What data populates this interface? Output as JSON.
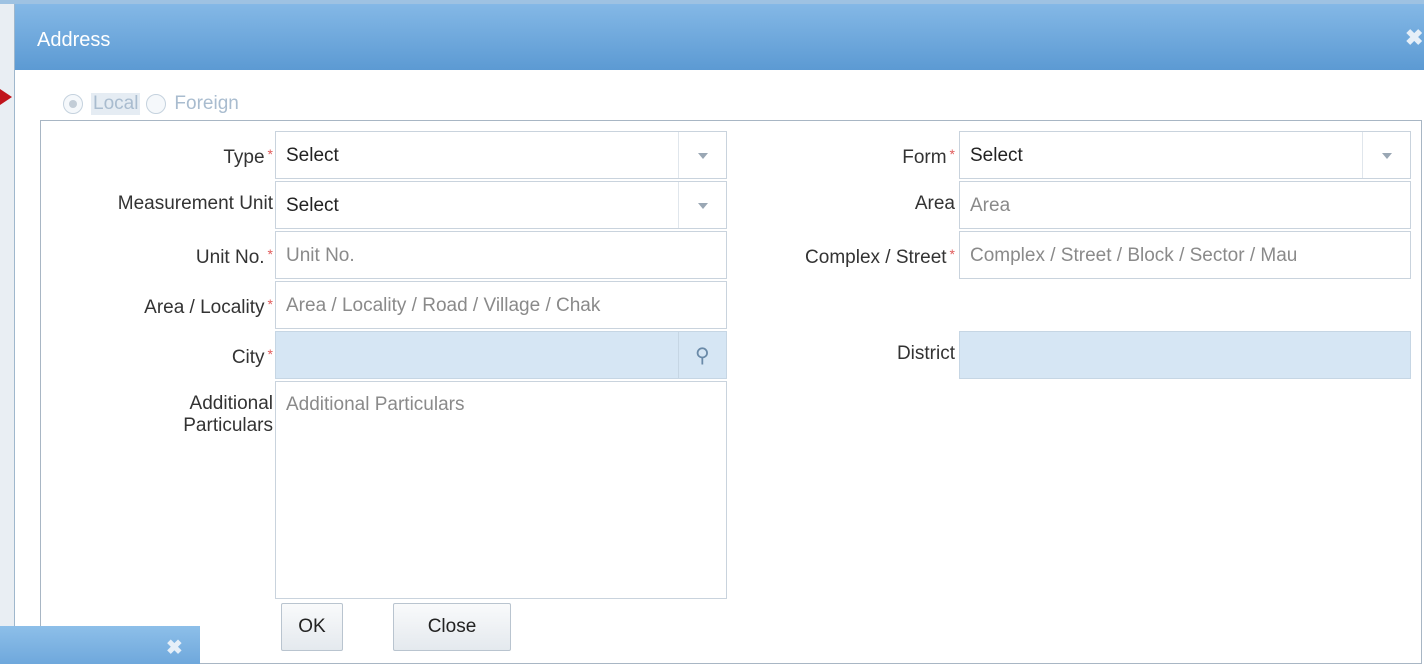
{
  "dialog": {
    "title": "Address",
    "close_icon": "close-icon"
  },
  "location_type": {
    "options": [
      {
        "label": "Local",
        "checked": true
      },
      {
        "label": "Foreign",
        "checked": false
      }
    ]
  },
  "form": {
    "type": {
      "label": "Type",
      "value": "Select"
    },
    "form": {
      "label": "Form",
      "value": "Select"
    },
    "measurement_unit": {
      "label": "Measurement Unit",
      "value": "Select"
    },
    "area": {
      "label": "Area",
      "placeholder": "Area"
    },
    "unit_no": {
      "label": "Unit No.",
      "placeholder": "Unit No."
    },
    "complex_street": {
      "label": "Complex / Street",
      "placeholder": "Complex / Street / Block / Sector / Mau"
    },
    "area_locality": {
      "label": "Area / Locality",
      "placeholder": "Area / Locality / Road / Village / Chak"
    },
    "city": {
      "label": "City",
      "value": ""
    },
    "district": {
      "label": "District",
      "value": ""
    },
    "additional_particulars": {
      "label_line1": "Additional",
      "label_line2": "Particulars",
      "placeholder": "Additional Particulars"
    },
    "required_mark": "*"
  },
  "buttons": {
    "ok": "OK",
    "close": "Close"
  },
  "icons": {
    "dropdown": "chevron-down-icon",
    "search": "search-icon",
    "pointer": "arrow-right-icon"
  },
  "colors": {
    "titlebar": "#5c9ad3",
    "required": "#e05a5a",
    "readonly_field": "#d6e6f4"
  }
}
